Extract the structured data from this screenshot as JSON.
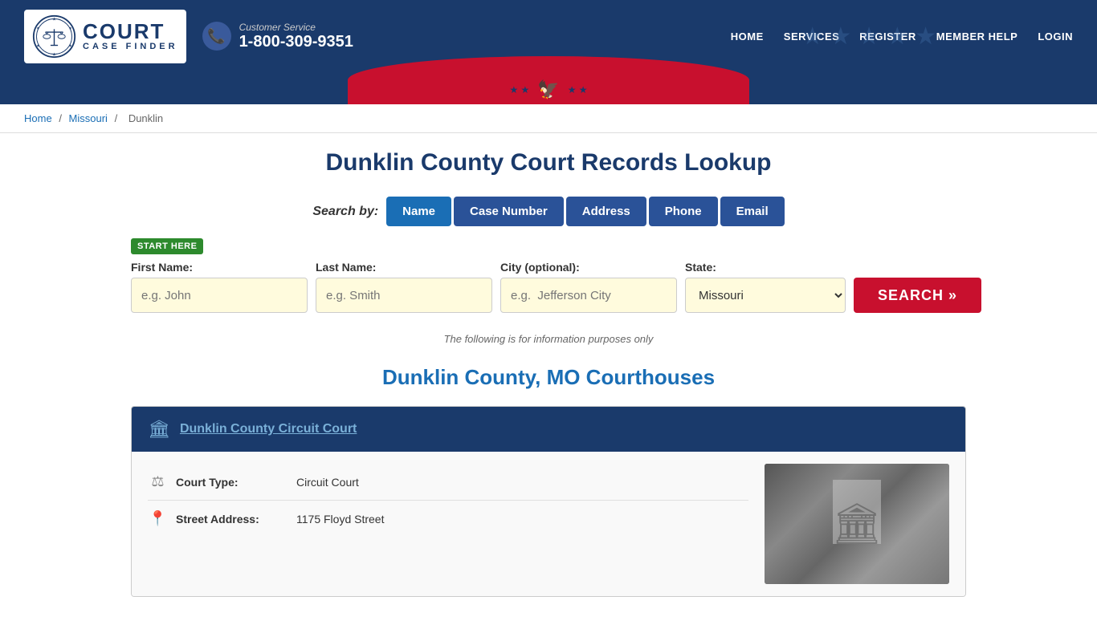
{
  "header": {
    "logo": {
      "court_label": "COURT",
      "finder_label": "CASE FINDER"
    },
    "customer_service": {
      "label": "Customer Service",
      "phone": "1-800-309-9351"
    },
    "nav": {
      "items": [
        "HOME",
        "SERVICES",
        "REGISTER",
        "MEMBER HELP",
        "LOGIN"
      ]
    }
  },
  "breadcrumb": {
    "items": [
      "Home",
      "Missouri",
      "Dunklin"
    ]
  },
  "main": {
    "page_title": "Dunklin County Court Records Lookup",
    "search": {
      "label": "Search by:",
      "tabs": [
        {
          "label": "Name",
          "active": true
        },
        {
          "label": "Case Number",
          "active": false
        },
        {
          "label": "Address",
          "active": false
        },
        {
          "label": "Phone",
          "active": false
        },
        {
          "label": "Email",
          "active": false
        }
      ],
      "start_here": "START HERE",
      "fields": {
        "first_name": {
          "label": "First Name:",
          "placeholder": "e.g. John"
        },
        "last_name": {
          "label": "Last Name:",
          "placeholder": "e.g. Smith"
        },
        "city": {
          "label": "City (optional):",
          "placeholder": "e.g.  Jefferson City"
        },
        "state": {
          "label": "State:",
          "value": "Missouri"
        }
      },
      "button_label": "SEARCH »"
    },
    "info_note": "The following is for information purposes only",
    "courthouses_title": "Dunklin County, MO Courthouses",
    "courthouse": {
      "name": "Dunklin County Circuit Court",
      "details": [
        {
          "label": "Court Type:",
          "value": "Circuit Court"
        },
        {
          "label": "Street Address:",
          "value": "1175 Floyd Street"
        }
      ]
    }
  }
}
